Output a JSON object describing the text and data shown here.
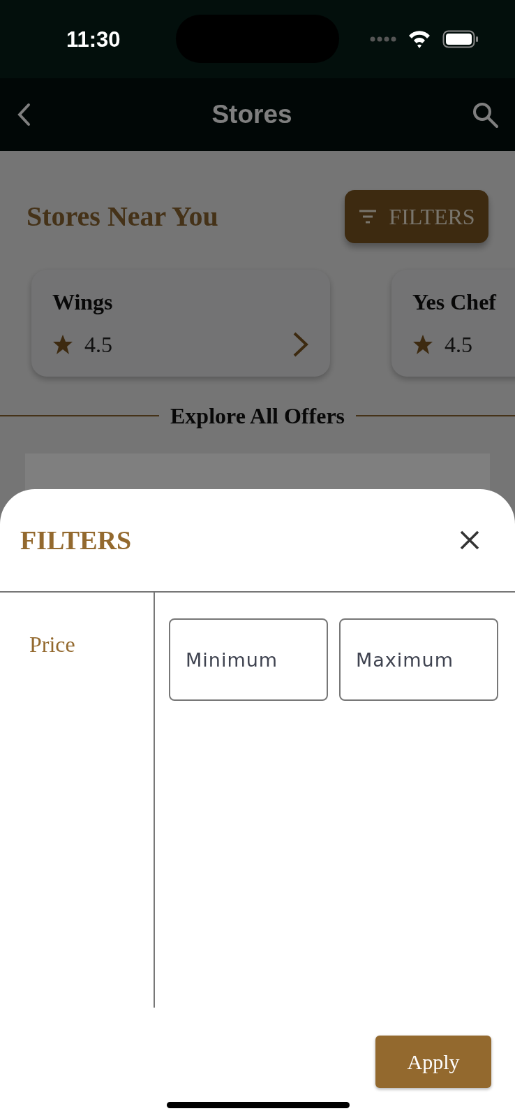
{
  "status_bar": {
    "time": "11:30"
  },
  "nav": {
    "title": "Stores"
  },
  "section": {
    "title": "Stores Near You",
    "filter_button": "FILTERS"
  },
  "stores": [
    {
      "name": "Wings",
      "rating": "4.5",
      "arrow": true
    },
    {
      "name": "Yes Chef",
      "rating": "4.5"
    }
  ],
  "divider_title": "Explore All Offers",
  "sheet": {
    "title": "FILTERS",
    "categories": [
      {
        "label": "Price",
        "selected": true
      }
    ],
    "fields": [
      {
        "placeholder": "Minimum"
      },
      {
        "placeholder": "Maximum"
      }
    ],
    "apply": "Apply"
  }
}
